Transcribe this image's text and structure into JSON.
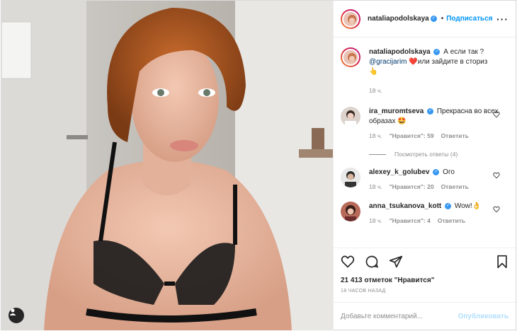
{
  "post": {
    "username": "nataliapodolskaya",
    "dot": "•",
    "follow_label": "Подписаться",
    "more_label": "···"
  },
  "caption": {
    "username": "nataliapodolskaya",
    "text": "А если так ?",
    "mention": "@gracijarim",
    "text2": "❤️или зайдите в сториз",
    "emoji": "👆",
    "time": "18 ч."
  },
  "comments": [
    {
      "username": "ira_muromtseva",
      "text": "Прекрасна во всех образах 🤩",
      "time": "18 ч.",
      "likes": "\"Нравится\": 59",
      "reply": "Ответить"
    },
    {
      "username": "alexey_k_golubev",
      "text": "Ого",
      "time": "18 ч.",
      "likes": "\"Нравится\": 20",
      "reply": "Ответить"
    },
    {
      "username": "anna_tsukanova_kott",
      "text": "Wow!👌",
      "time": "18 ч.",
      "likes": "\"Нравится\": 4",
      "reply": "Ответить"
    }
  ],
  "view_replies": "Посмотреть ответы (4)",
  "likes_count": "21 413 отметок \"Нравится\"",
  "posted_time": "18 ЧАСОВ НАЗАД",
  "add_comment": {
    "placeholder": "Добавьте комментарий...",
    "publish": "Опубликовать"
  },
  "colors": {
    "accent": "#0095f6",
    "verified": "#3897f0",
    "heart": "#ed4956"
  },
  "icons": [
    "user-tag-icon",
    "heart-icon",
    "comment-icon",
    "share-icon",
    "bookmark-icon",
    "verified-icon",
    "more-icon"
  ]
}
